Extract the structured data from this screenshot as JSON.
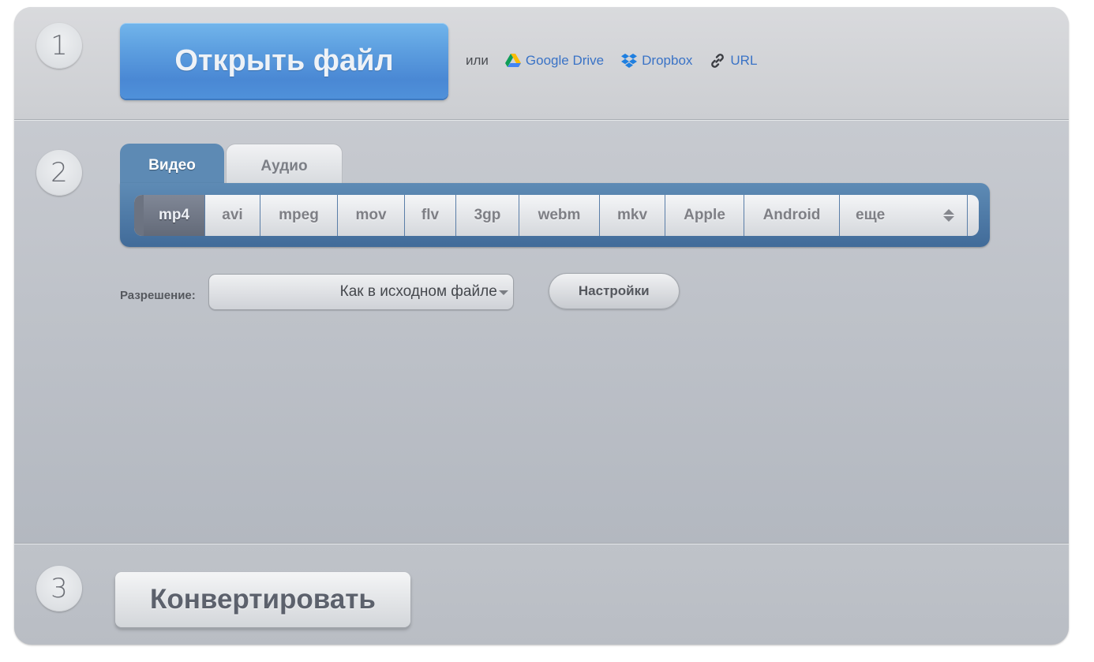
{
  "steps": {
    "one": "1",
    "two": "2",
    "three": "3"
  },
  "open_file": {
    "label": "Открыть файл",
    "color": "#4a88d4"
  },
  "alt_sources": {
    "or_label": "или",
    "links": [
      {
        "label": "Google Drive",
        "icon": "google-drive-icon"
      },
      {
        "label": "Dropbox",
        "icon": "dropbox-icon"
      },
      {
        "label": "URL",
        "icon": "link-icon"
      }
    ],
    "link_color": "#3a73c6"
  },
  "tabs": [
    {
      "label": "Видео",
      "active": true
    },
    {
      "label": "Аудио",
      "active": false
    }
  ],
  "formats": [
    {
      "label": "mp4",
      "active": true
    },
    {
      "label": "avi"
    },
    {
      "label": "mpeg"
    },
    {
      "label": "mov"
    },
    {
      "label": "flv"
    },
    {
      "label": "3gp"
    },
    {
      "label": "webm"
    },
    {
      "label": "mkv"
    },
    {
      "label": "Apple"
    },
    {
      "label": "Android"
    },
    {
      "label": "еще",
      "icon": "updown-icon"
    }
  ],
  "resolution": {
    "label": "Разрешение:",
    "selected": "Как в исходном файле"
  },
  "settings_label": "Настройки",
  "convert_label": "Конвертировать",
  "colors": {
    "panel_blue": "#5d8ab4"
  }
}
